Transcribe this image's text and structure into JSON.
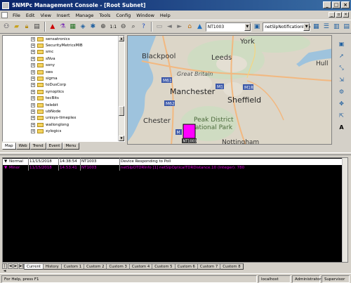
{
  "window": {
    "title": "SNMPc Management Console - [Root Subnet]"
  },
  "menu": [
    "File",
    "Edit",
    "View",
    "Insert",
    "Manage",
    "Tools",
    "Config",
    "Window",
    "Help"
  ],
  "toolbar": {
    "node_combo": "NT1003",
    "event_combo": "netSlpNotificationInfo"
  },
  "tree": {
    "items": [
      "sensatronics",
      "SecurityMetricsMIB",
      "smc",
      "sNva",
      "sony",
      "sws",
      "sigma",
      "toDusCorp",
      "synoptics",
      "tecBits",
      "telebit",
      "ubNode",
      "unisys-timeplex",
      "wallonglong",
      "xylogics"
    ]
  },
  "left_tabs": [
    "Map",
    "Web",
    "Trend",
    "Event",
    "Menu"
  ],
  "map": {
    "labels": {
      "york": "York",
      "blackpool": "Blackpool",
      "leeds": "Leeds",
      "hull": "Hull",
      "great_britain": "Great Britain",
      "manchester": "Manchester",
      "sheffield": "Sheffield",
      "chester": "Chester",
      "peak_district": "Peak District",
      "national_park": "ational Park",
      "nottingham": "Nottingham"
    },
    "roads": {
      "m61": "M61",
      "m1": "M1",
      "m18": "M18",
      "m62": "M62",
      "m6": "M"
    },
    "device_label": "NT1003",
    "device_color": "#ff00ff"
  },
  "events": [
    {
      "severity": "Normal",
      "date": "11/15/2018",
      "time": "14:38:54",
      "source": "NT1003",
      "message": "Device Responding to Poll",
      "color": "#000000"
    },
    {
      "severity": "Minor",
      "date": "11/15/2018",
      "time": "14:53:41",
      "source": "NT1003",
      "message": "netSlpOTDRInfo [1] netSlpOpticalTDRDistance.10 (Integer): 780",
      "color": "#e000e0"
    }
  ],
  "bottom_tabs": [
    "Current",
    "History",
    "Custom 1",
    "Custom 2",
    "Custom 3",
    "Custom 4",
    "Custom 5",
    "Custom 6",
    "Custom 7",
    "Custom 8"
  ],
  "status": {
    "help": "For Help, press F1",
    "host": "localhost",
    "user": "Administrator",
    "role": "Supervisor"
  }
}
